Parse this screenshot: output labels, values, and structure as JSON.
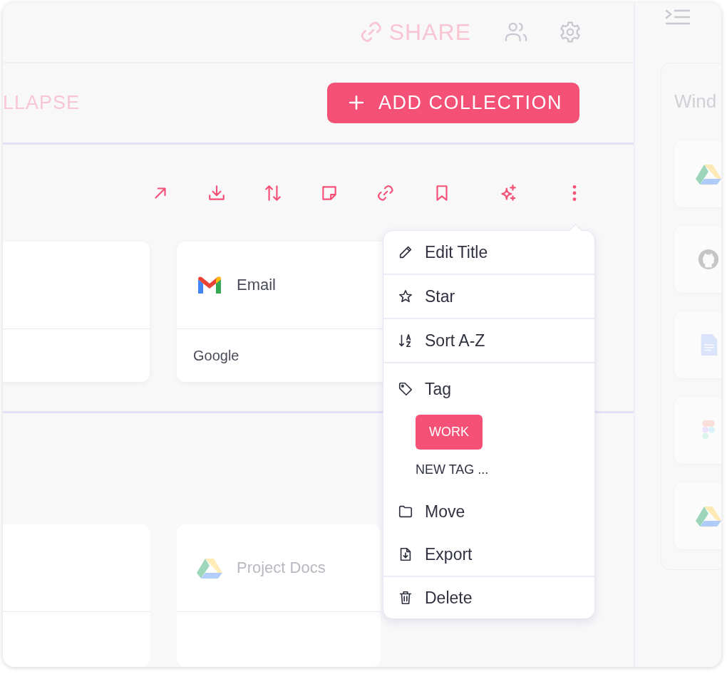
{
  "top_bar": {
    "share_label": "SHARE"
  },
  "header": {
    "collapse_label": "LLAPSE",
    "add_button": "ADD COLLECTION"
  },
  "cards": [
    {
      "kind": "blank"
    },
    {
      "kind": "gmail",
      "title": "Email",
      "subtitle": "Google"
    }
  ],
  "lower_cards": [
    {
      "kind": "blank"
    },
    {
      "kind": "drive",
      "title": "Project Docs"
    }
  ],
  "menu": {
    "groups": [
      [
        {
          "kind": "edit",
          "label": "Edit Title"
        }
      ],
      [
        {
          "kind": "star",
          "label": "Star"
        }
      ],
      [
        {
          "kind": "sort",
          "label": "Sort A-Z"
        }
      ],
      [
        {
          "kind": "tag",
          "label": "Tag",
          "tags": [
            {
              "label": "WORK",
              "selected": true
            }
          ],
          "new_tag": "NEW TAG ..."
        },
        {
          "kind": "move",
          "label": "Move"
        },
        {
          "kind": "export",
          "label": "Export"
        }
      ],
      [
        {
          "kind": "delete",
          "label": "Delete"
        }
      ]
    ]
  },
  "side_panel": {
    "title": "Wind",
    "apps": [
      {
        "kind": "drive"
      },
      {
        "kind": "github"
      },
      {
        "kind": "doc"
      },
      {
        "kind": "figma"
      },
      {
        "kind": "drive"
      }
    ]
  }
}
